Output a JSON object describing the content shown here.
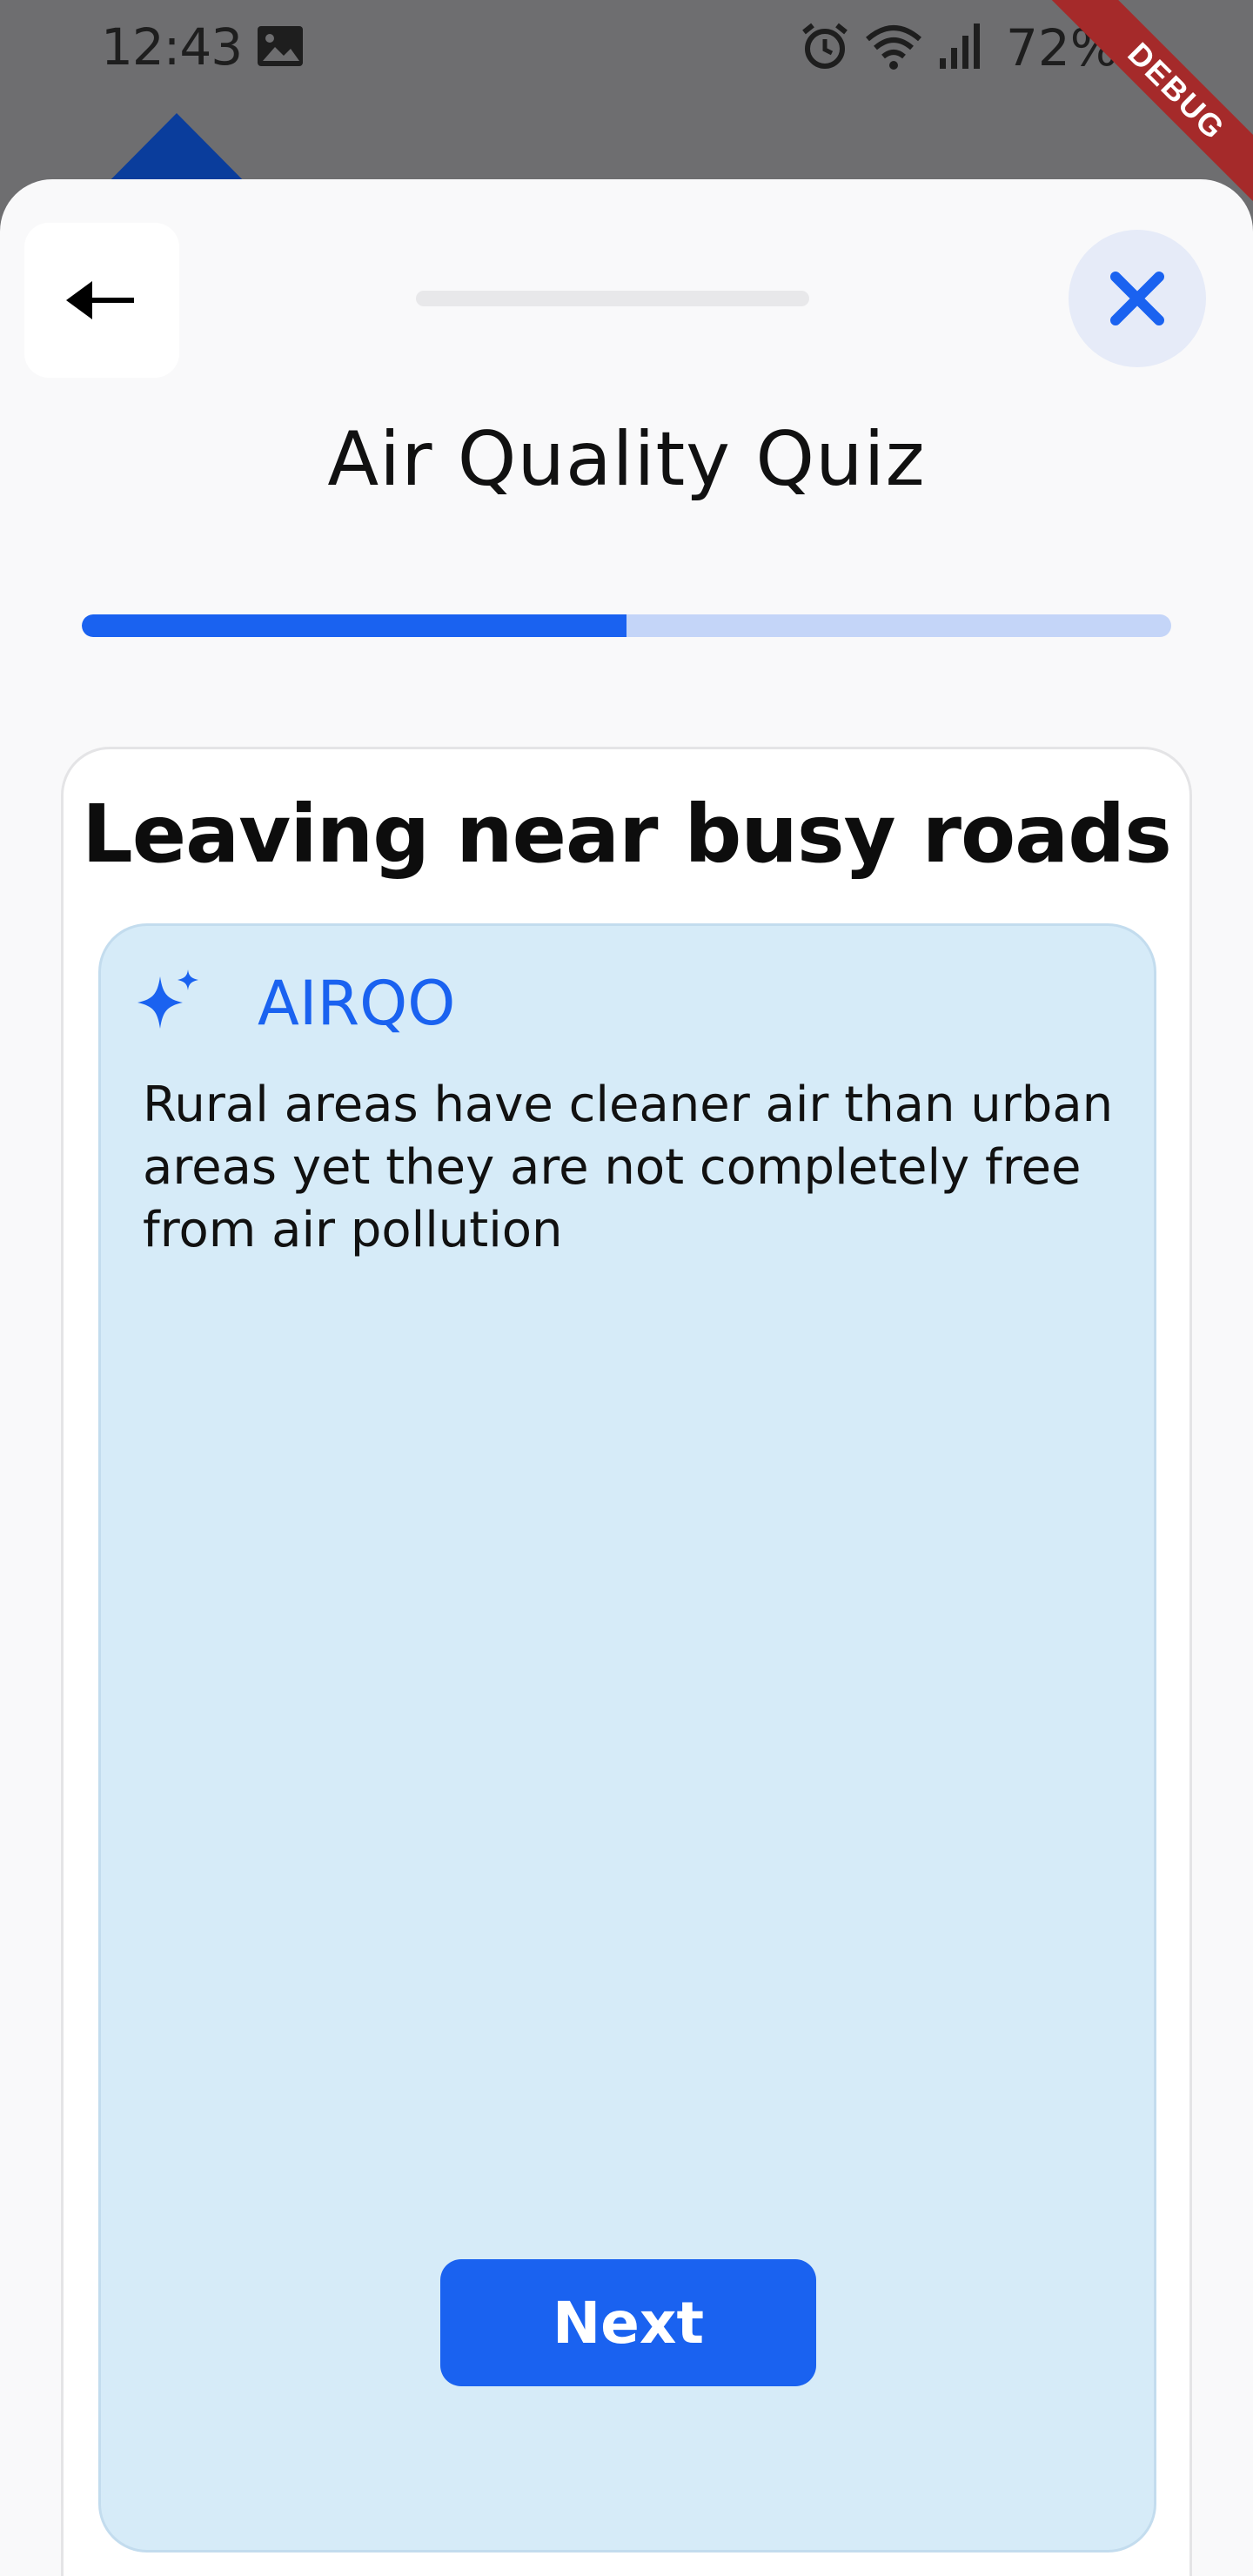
{
  "status_bar": {
    "time": "12:43",
    "battery": "72%",
    "icons": [
      "gallery-icon",
      "alarm-icon",
      "wifi-icon",
      "signal-icon",
      "battery-icon"
    ]
  },
  "debug_banner": "DEBUG",
  "sheet": {
    "title": "Air Quality Quiz",
    "progress": 0.5
  },
  "card": {
    "title": "Leaving near busy roads",
    "brand": "AIRQO",
    "message": "Rural areas have cleaner air than urban areas yet they are not completely  free from air pollution",
    "next_label": "Next"
  },
  "colors": {
    "accent": "#1a62f0",
    "progress_track": "#c4d5f8",
    "info_background": "#d6ebf8",
    "close_background": "#e6ebf8",
    "debug": "#a52a2a"
  }
}
